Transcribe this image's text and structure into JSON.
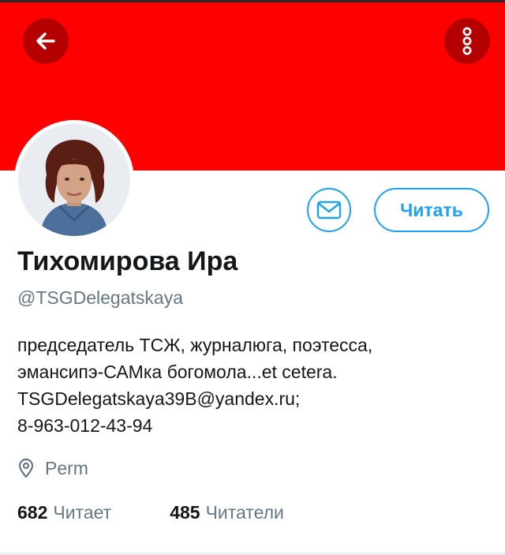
{
  "colors": {
    "banner": "#ff0000",
    "accent": "#1da1f2",
    "text_primary": "#14171a",
    "text_secondary": "#657786"
  },
  "header": {
    "back_icon": "arrow-left-icon",
    "more_icon": "more-vertical-icon"
  },
  "profile": {
    "name": "Тихомирова Ира",
    "handle": "@TSGDelegatskaya",
    "bio_lines": [
      "председатель ТСЖ, журналюга, поэтесса,",
      "эмансипэ-САМка богомола...et cetera.",
      "TSGDelegatskaya39B@yandex.ru;",
      "8-963-012-43-94"
    ],
    "location": "Perm"
  },
  "actions": {
    "message_icon": "envelope-icon",
    "follow_label": "Читать"
  },
  "stats": {
    "following_count": "682",
    "following_label": "Читает",
    "followers_count": "485",
    "followers_label": "Читатели"
  }
}
